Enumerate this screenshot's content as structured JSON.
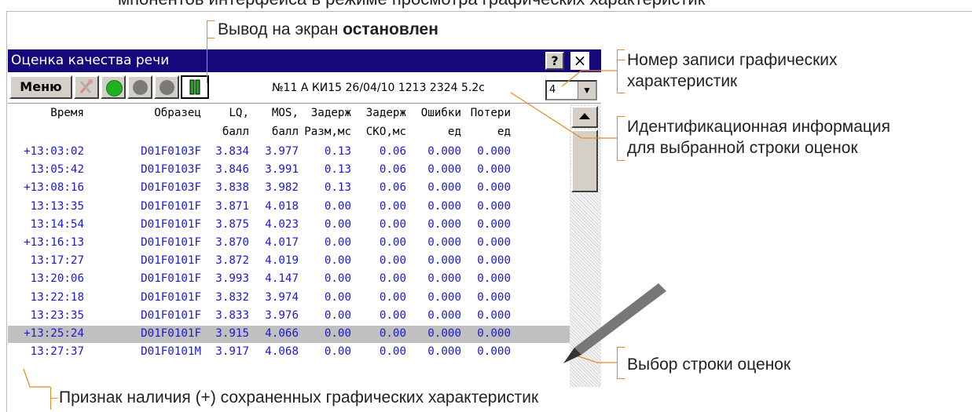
{
  "top_banner_text": "мпонентов интерфейса в режиме просмотра графических характеристик",
  "callouts": {
    "output_stopped_prefix": "Вывод на экран ",
    "output_stopped_bold": "остановлен",
    "record_number_line1": "Номер записи графических",
    "record_number_line2": "характеристик",
    "ident_info_line1": "Идентификационная информация",
    "ident_info_line2": "для выбранной строки оценок",
    "row_select": "Выбор строки оценок",
    "saved_sign": "Признак наличия (+) сохраненных графических характеристик"
  },
  "window": {
    "title": "Оценка качества речи",
    "help_label": "?",
    "close_label": "×"
  },
  "toolbar": {
    "menu_label": "Меню",
    "info_text": "№11  А КИ15 26/04/10  1213 2324  5.2c",
    "record_select_value": "4",
    "dropdown_arrow": "▼"
  },
  "colors": {
    "titlebar": "#14087a",
    "row_text": "#1a1ad0",
    "callout_line": "#e48a24",
    "selected_row": "#c0c0c0",
    "green_indicator": "#22b022",
    "grey_indicator": "#7a7a7a"
  },
  "table": {
    "headers_line1": [
      "Время",
      "Образец",
      "LQ,",
      "MOS,",
      "Задерж",
      "Задерж",
      "Ошибки",
      "Потери"
    ],
    "headers_line2": [
      "",
      "",
      "балл",
      "балл",
      "Разм,мс",
      "СКО,мс",
      "ед",
      "ед"
    ],
    "rows": [
      [
        "+13:03:02",
        "D01F0103F",
        "3.834",
        "3.977",
        "0.13",
        "0.06",
        "0.000",
        "0.000"
      ],
      [
        "13:05:42",
        "D01F0103F",
        "3.846",
        "3.991",
        "0.13",
        "0.06",
        "0.000",
        "0.000"
      ],
      [
        "+13:08:16",
        "D01F0103F",
        "3.838",
        "3.982",
        "0.13",
        "0.06",
        "0.000",
        "0.000"
      ],
      [
        "13:13:35",
        "D01F0101F",
        "3.871",
        "4.018",
        "0.00",
        "0.00",
        "0.000",
        "0.000"
      ],
      [
        "13:14:54",
        "D01F0101F",
        "3.875",
        "4.023",
        "0.00",
        "0.00",
        "0.000",
        "0.000"
      ],
      [
        "+13:16:13",
        "D01F0101F",
        "3.870",
        "4.017",
        "0.00",
        "0.00",
        "0.000",
        "0.000"
      ],
      [
        "13:17:27",
        "D01F0101F",
        "3.872",
        "4.019",
        "0.00",
        "0.00",
        "0.000",
        "0.000"
      ],
      [
        "13:20:06",
        "D01F0101F",
        "3.993",
        "4.147",
        "0.00",
        "0.00",
        "0.000",
        "0.000"
      ],
      [
        "13:22:18",
        "D01F0101F",
        "3.832",
        "3.974",
        "0.00",
        "0.00",
        "0.000",
        "0.000"
      ],
      [
        "13:23:35",
        "D01F0101F",
        "3.833",
        "3.976",
        "0.00",
        "0.00",
        "0.000",
        "0.000"
      ],
      [
        "+13:25:24",
        "D01F0101F",
        "3.915",
        "4.066",
        "0.00",
        "0.00",
        "0.000",
        "0.000"
      ],
      [
        "13:27:37",
        "D01F0101M",
        "3.917",
        "4.068",
        "0.00",
        "0.00",
        "0.000",
        "0.000"
      ]
    ],
    "selected_index": 10
  }
}
